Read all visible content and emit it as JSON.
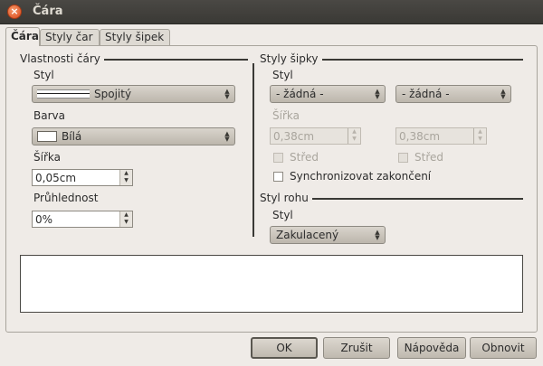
{
  "window": {
    "title": "Čára"
  },
  "tabs": [
    {
      "label": "Čára",
      "active": true
    },
    {
      "label": "Styly čar",
      "active": false
    },
    {
      "label": "Styly šipek",
      "active": false
    }
  ],
  "line_properties": {
    "title": "Vlastnosti čáry",
    "style_label": "Styl",
    "style_value": "Spojitý",
    "color_label": "Barva",
    "color_value": "Bílá",
    "width_label": "Šířka",
    "width_value": "0,05cm",
    "transparency_label": "Průhlednost",
    "transparency_value": "0%"
  },
  "arrow_styles": {
    "title": "Styly šipky",
    "style_label": "Styl",
    "start_style": "- žádná -",
    "end_style": "- žádná -",
    "width_label": "Šířka",
    "start_width": "0,38cm",
    "end_width": "0,38cm",
    "center_label_1": "Střed",
    "center_label_2": "Střed",
    "sync_label": "Synchronizovat zakončení"
  },
  "corner_style": {
    "title": "Styl rohu",
    "style_label": "Styl",
    "style_value": "Zakulacený"
  },
  "buttons": {
    "ok": "OK",
    "cancel": "Zrušit",
    "help": "Nápověda",
    "reset": "Obnovit"
  }
}
